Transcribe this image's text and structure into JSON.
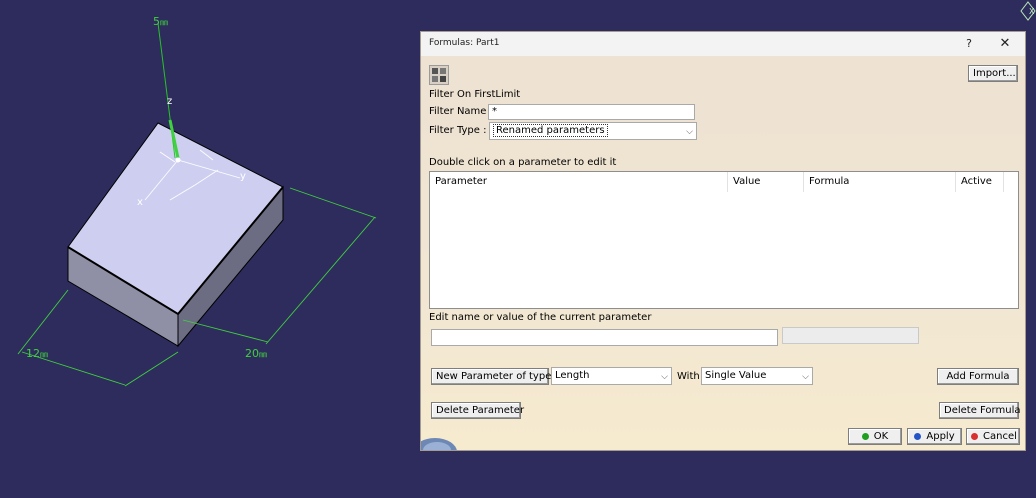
{
  "viewport": {
    "dim_height": "5",
    "dim_width": "12",
    "dim_length": "20",
    "unit_glyph": "㎜",
    "axis_z": "z",
    "axis_y": "y",
    "axis_x": "x",
    "compass_label": "X"
  },
  "dialog": {
    "title": "Formulas: Part1",
    "help": "?",
    "close": "✕",
    "import_button": "Import...",
    "filter_section": "Filter On FirstLimit",
    "filter_name_label": "Filter Name :",
    "filter_name_value": "*",
    "filter_type_label": "Filter Type :",
    "filter_type_value": "Renamed parameters",
    "table_hint": "Double click on a parameter to edit it",
    "columns": [
      "Parameter",
      "Value",
      "Formula",
      "Active"
    ],
    "edit_label": "Edit name or value of the current parameter",
    "edit_value": "",
    "new_param_button": "New Parameter of type",
    "new_param_type": "Length",
    "with_label": "With",
    "with_value": "Single Value",
    "add_formula_button": "Add Formula",
    "delete_param_button": "Delete Parameter",
    "delete_formula_button": "Delete Formula",
    "ok_button": "OK",
    "apply_button": "Apply",
    "cancel_button": "Cancel"
  },
  "colors": {
    "background": "#2e2c5c",
    "dimension": "#3fd13f",
    "box_top": "#cdcdf0",
    "ok_green": "#1f9e1f",
    "apply_blue": "#2455c8",
    "cancel_red": "#d83030"
  }
}
